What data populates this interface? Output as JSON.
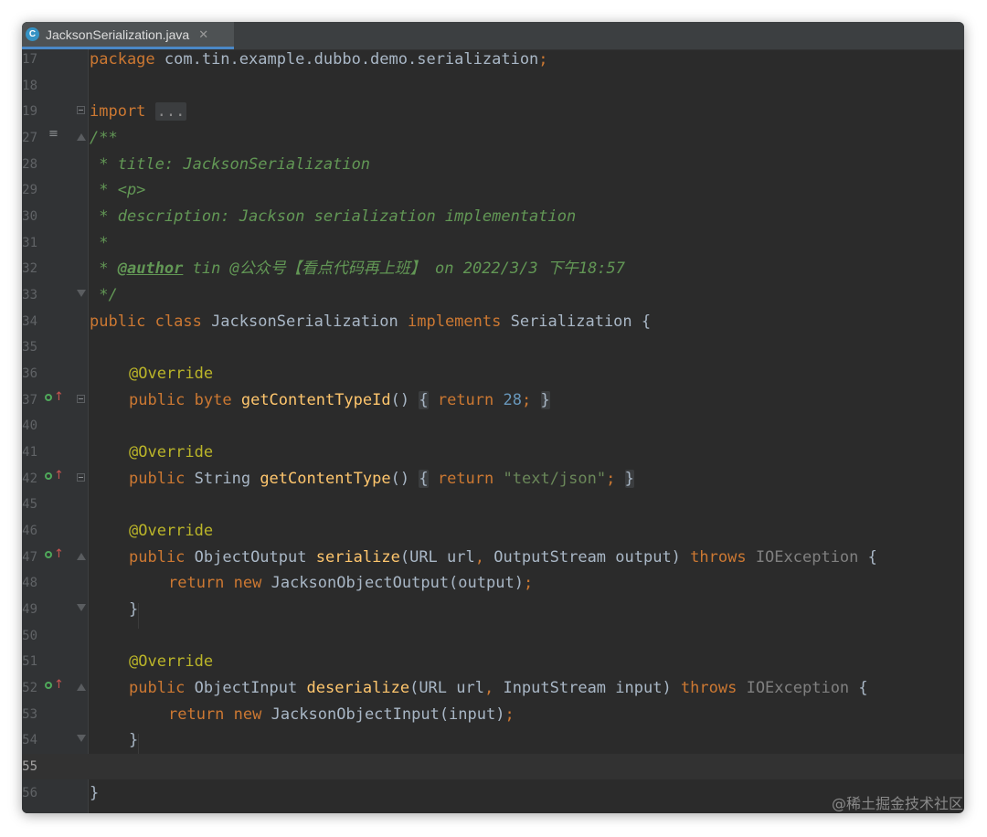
{
  "tab": {
    "icon": "C",
    "filename": "JacksonSerialization.java",
    "close": "✕"
  },
  "lines": {
    "l17": {
      "num": "17",
      "kw": "package",
      "rest": " com.tin.example.dubbo.demo.serialization",
      "semi": ";"
    },
    "l18": {
      "num": "18"
    },
    "l19": {
      "num": "19",
      "kw": "import",
      "folded": "..."
    },
    "l27": {
      "num": "27",
      "text": "/**"
    },
    "l28": {
      "num": "28",
      "text": " * title: JacksonSerialization"
    },
    "l29": {
      "num": "29",
      "text": " * <p>"
    },
    "l30": {
      "num": "30",
      "text": " * description: Jackson serialization implementation"
    },
    "l31": {
      "num": "31",
      "text": " *"
    },
    "l32": {
      "num": "32",
      "pre": " * ",
      "tag": "@author",
      "post": " tin @公众号【看点代码再上班】 on 2022/3/3 下午18:57"
    },
    "l33": {
      "num": "33",
      "text": " */"
    },
    "l34": {
      "num": "34",
      "kw1": "public class",
      "name": " JacksonSerialization ",
      "kw2": "implements",
      "rest": " Serialization {"
    },
    "l35": {
      "num": "35"
    },
    "l36": {
      "num": "36",
      "ann": "@Override"
    },
    "l37": {
      "num": "37",
      "kw1": "public byte",
      "fn": "getContentTypeId",
      "parens": "()",
      "open": "{",
      "ret": "return",
      "val": "28",
      "semi": ";",
      "close": "}"
    },
    "l40": {
      "num": "40"
    },
    "l41": {
      "num": "41",
      "ann": "@Override"
    },
    "l42": {
      "num": "42",
      "kw1": "public",
      "type": " String ",
      "fn": "getContentType",
      "parens": "()",
      "open": "{",
      "ret": "return",
      "val": "\"text/json\"",
      "semi": ";",
      "close": "}"
    },
    "l45": {
      "num": "45"
    },
    "l46": {
      "num": "46",
      "ann": "@Override"
    },
    "l47": {
      "num": "47",
      "kw1": "public",
      "type": " ObjectOutput ",
      "fn": "serialize",
      "params": "(URL url",
      "comma": ",",
      "params2": " OutputStream output) ",
      "throws": "throws",
      "exc": " IOException",
      "brace": " {"
    },
    "l48": {
      "num": "48",
      "ret": "return new",
      "rest": " JacksonObjectOutput(output)",
      "semi": ";"
    },
    "l49": {
      "num": "49",
      "text": "}"
    },
    "l50": {
      "num": "50"
    },
    "l51": {
      "num": "51",
      "ann": "@Override"
    },
    "l52": {
      "num": "52",
      "kw1": "public",
      "type": " ObjectInput ",
      "fn": "deserialize",
      "params": "(URL url",
      "comma": ",",
      "params2": " InputStream input) ",
      "throws": "throws",
      "exc": " IOException",
      "brace": " {"
    },
    "l53": {
      "num": "53",
      "ret": "return new",
      "rest": " JacksonObjectInput(input)",
      "semi": ";"
    },
    "l54": {
      "num": "54",
      "text": "}"
    },
    "l55": {
      "num": "55"
    },
    "l56": {
      "num": "56",
      "text": "}"
    }
  },
  "watermark": "@稀土掘金技术社区",
  "colors": {
    "keyword": "#cc7832",
    "function": "#ffc66d",
    "annotation": "#bbb529",
    "number": "#6897bb",
    "string": "#6a8759",
    "doc": "#629755",
    "text": "#a9b7c6"
  }
}
